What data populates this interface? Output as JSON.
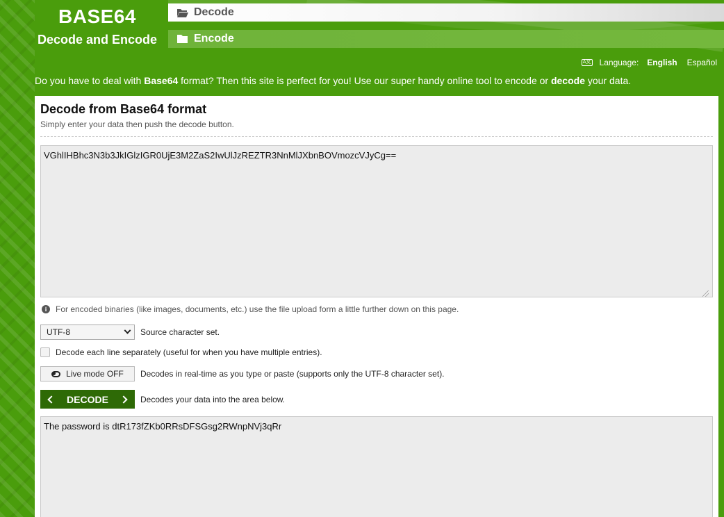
{
  "header": {
    "logo_title": "BASE64",
    "logo_subtitle": "Decode and Encode",
    "nav": [
      {
        "label": "Decode",
        "icon": "folder-open-icon"
      },
      {
        "label": "Encode",
        "icon": "folder-icon"
      }
    ]
  },
  "language": {
    "label": "Language:",
    "options": [
      "English",
      "Español"
    ],
    "selected": "English"
  },
  "intro": {
    "part1": "Do you have to deal with ",
    "bold1": "Base64",
    "part2": " format? Then this site is perfect for you! Use our super handy online tool to encode or ",
    "bold2": "decode",
    "part3": " your data."
  },
  "panel": {
    "title": "Decode from Base64 format",
    "subtitle": "Simply enter your data then push the decode button.",
    "input_value": "VGhlIHBhc3N3b3JkIGlzIGR0UjE3M2ZaS2IwUlJzREZTR3NnMlJXbnBOVmozcVJyCg==",
    "info_text": "For encoded binaries (like images, documents, etc.) use the file upload form a little further down on this page.",
    "charset": {
      "selected": "UTF-8",
      "label": "Source character set."
    },
    "each_line": {
      "label": "Decode each line separately (useful for when you have multiple entries)."
    },
    "live_mode": {
      "button": "Live mode OFF",
      "label": "Decodes in real-time as you type or paste (supports only the UTF-8 character set)."
    },
    "decode": {
      "button": "DECODE",
      "label": "Decodes your data into the area below."
    },
    "output_value": "The password is dtR173fZKb0RRsDFSGsg2RWnpNVj3qRr"
  }
}
